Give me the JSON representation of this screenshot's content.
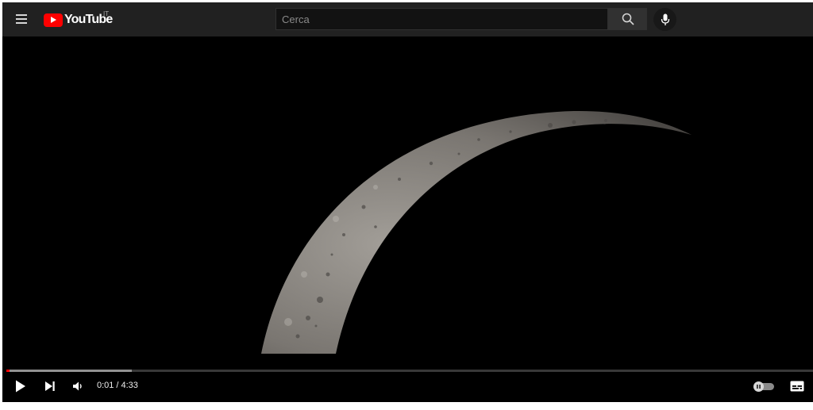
{
  "header": {
    "logo_text": "YouTube",
    "country_code": "IT"
  },
  "search": {
    "placeholder": "Cerca",
    "value": ""
  },
  "icons": {
    "menu": "hamburger-menu-icon",
    "search": "search-icon",
    "mic": "microphone-icon",
    "play": "play-icon",
    "next": "next-icon",
    "volume": "volume-icon",
    "autoplay": "autoplay-toggle-icon",
    "captions": "subtitles-icon"
  },
  "player": {
    "current_time": "0:01",
    "separator": "/",
    "duration": "4:33",
    "played_fraction": 0.0037,
    "buffered_fraction": 0.156,
    "autoplay_on": false
  },
  "colors": {
    "brand_red": "#ff0000",
    "masthead_bg": "#212121",
    "player_bg": "#000000"
  }
}
